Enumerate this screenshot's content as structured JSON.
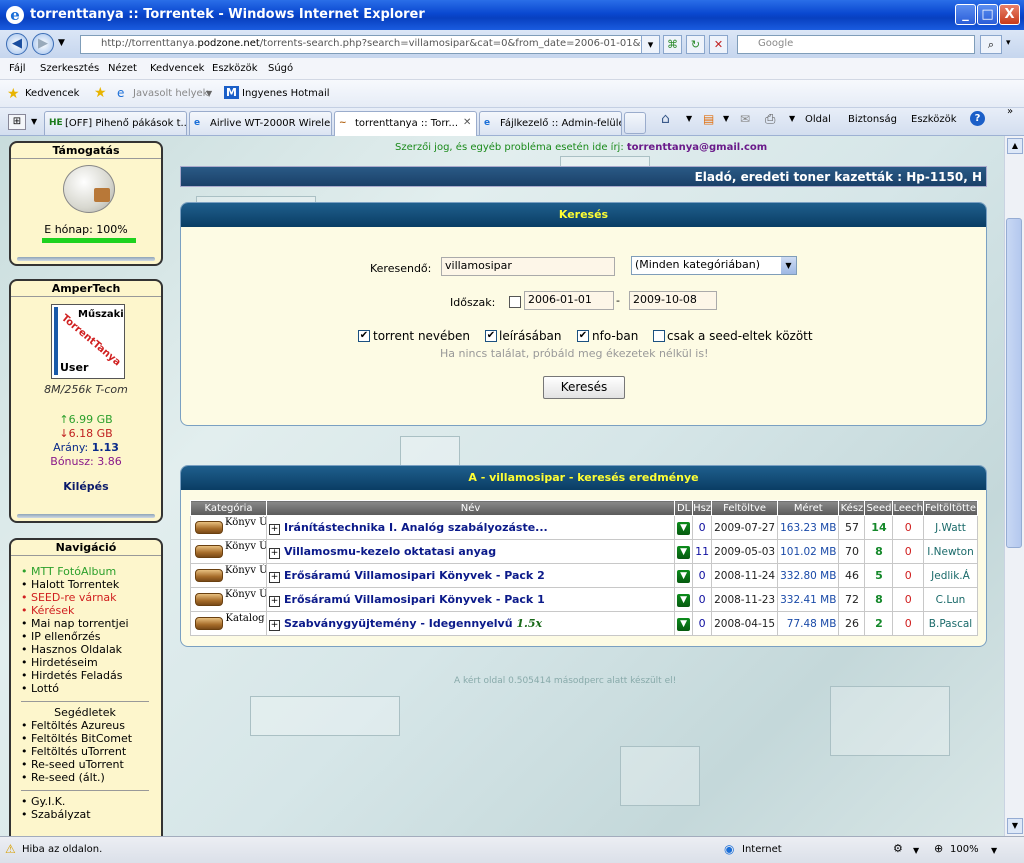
{
  "window": {
    "title": "torrenttanya :: Torrentek - Windows Internet Explorer",
    "min": "_",
    "max": "□",
    "close": "X"
  },
  "address": {
    "prefix": "http://torrenttanya.",
    "host": "podzone.net",
    "rest": "/torrents-search.php?search=villamosipar&cat=0&from_date=2006-01-01&to_date=2",
    "search_placeholder": "Google"
  },
  "menu": [
    "Fájl",
    "Szerkesztés",
    "Nézet",
    "Kedvencek",
    "Eszközök",
    "Súgó"
  ],
  "favorites": {
    "label": "Kedvencek",
    "suggested": "Javasolt helyek",
    "hotmail": "Ingyenes Hotmail"
  },
  "tabs": [
    "[OFF] Pihenő pákások t...",
    "Airlive WT-2000R Wirele...",
    "torrenttanya :: Torr...",
    "Fájlkezelő :: Admin-felület"
  ],
  "tab_icons": [
    "HE",
    "e",
    "~",
    "e"
  ],
  "commands": {
    "page": "Oldal",
    "security": "Biztonság",
    "tools": "Eszközök"
  },
  "sidebar": {
    "support": {
      "title": "Támogatás",
      "month": "E hónap: 100%",
      "progress": 1.0
    },
    "user": {
      "title": "AmperTech",
      "avatar_top": "Műszaki",
      "avatar_mid": "TorrentTanya",
      "avatar_bottom": "User",
      "connection": "8M/256k T-com",
      "up": "↑6.99 GB",
      "down": "↓6.18 GB",
      "ratio_label": "Arány:",
      "ratio": "1.13",
      "bonus_label": "Bónusz:",
      "bonus": "3.86",
      "logout": "Kilépés"
    },
    "nav": {
      "title": "Navigáció",
      "items": [
        "MTT FotóAlbum",
        "Halott Torrentek",
        "SEED-re várnak",
        "Kérések",
        "Mai nap torrentjei",
        "IP ellenőrzés",
        "Hasznos Oldalak",
        "Hirdetéseim",
        "Hirdetés Feladás",
        "Lottó"
      ],
      "helpers_title": "Segédletek",
      "helpers": [
        "Feltöltés Azureus",
        "Feltöltés BitComet",
        "Feltöltés uTorrent",
        "Re-seed uTorrent",
        "Re-seed (ált.)"
      ],
      "misc": [
        "Gy.I.K.",
        "Szabályzat"
      ]
    }
  },
  "main": {
    "copyright_text": "Szerzői jog, és egyéb probléma esetén ide írj:",
    "copyright_email": "torrenttanya@gmail.com",
    "marquee": "Eladó, eredeti toner kazetták : Hp-1150,  H",
    "search": {
      "title": "Keresés",
      "term_label": "Keresendő:",
      "term": "villamosipar",
      "category": "(Minden kategóriában)",
      "period_label": "Időszak:",
      "from": "2006-01-01",
      "to": "2009-10-08",
      "dash": "-",
      "opt_name": "torrent nevében",
      "opt_desc": "leírásában",
      "opt_nfo": "nfo-ban",
      "opt_seed": "csak a seed-eltek között",
      "hint": "Ha nincs találat, próbáld meg ékezetek nélkül is!",
      "button": "Keresés"
    },
    "results": {
      "title": "A - villamosipar - keresés eredménye",
      "columns": [
        "Kategória",
        "Név",
        "DL",
        "Hsz",
        "Feltöltve",
        "Méret",
        "Kész",
        "Seed",
        "Leech",
        "Feltöltötte"
      ],
      "rows": [
        {
          "cat": "Könyv Újság",
          "name": "Iránítástechnika I. Analóg szabályozáste...",
          "extra": "",
          "hsz": "0",
          "date": "2009-07-27",
          "size": "163.23 MB",
          "done": "57",
          "seed": "14",
          "leech": "0",
          "uploader": "J.Watt"
        },
        {
          "cat": "Könyv Újság",
          "name": "Villamosmu-kezelo oktatasi anyag",
          "extra": "",
          "hsz": "11",
          "date": "2009-05-03",
          "size": "101.02 MB",
          "done": "70",
          "seed": "8",
          "leech": "0",
          "uploader": "I.Newton"
        },
        {
          "cat": "Könyv Újság",
          "name": "Erősáramú Villamosipari Könyvek - Pack 2",
          "extra": "",
          "hsz": "0",
          "date": "2008-11-24",
          "size": "332.80 MB",
          "done": "46",
          "seed": "5",
          "leech": "0",
          "uploader": "Jedlik.Á"
        },
        {
          "cat": "Könyv Újság",
          "name": "Erősáramú Villamosipari Könyvek - Pack 1",
          "extra": "",
          "hsz": "0",
          "date": "2008-11-23",
          "size": "332.41 MB",
          "done": "72",
          "seed": "8",
          "leech": "0",
          "uploader": "C.Lun"
        },
        {
          "cat": "Katalog",
          "name": "Szabványgyüjtemény - Idegennyelvű",
          "extra": "1.5x",
          "hsz": "0",
          "date": "2008-04-15",
          "size": "77.48 MB",
          "done": "26",
          "seed": "2",
          "leech": "0",
          "uploader": "B.Pascal"
        }
      ]
    },
    "footer": "A kért oldal 0.505414 másodperc alatt készült el!"
  },
  "status": {
    "left": "Hiba az oldalon.",
    "zone": "Internet",
    "zoom": "100%"
  }
}
